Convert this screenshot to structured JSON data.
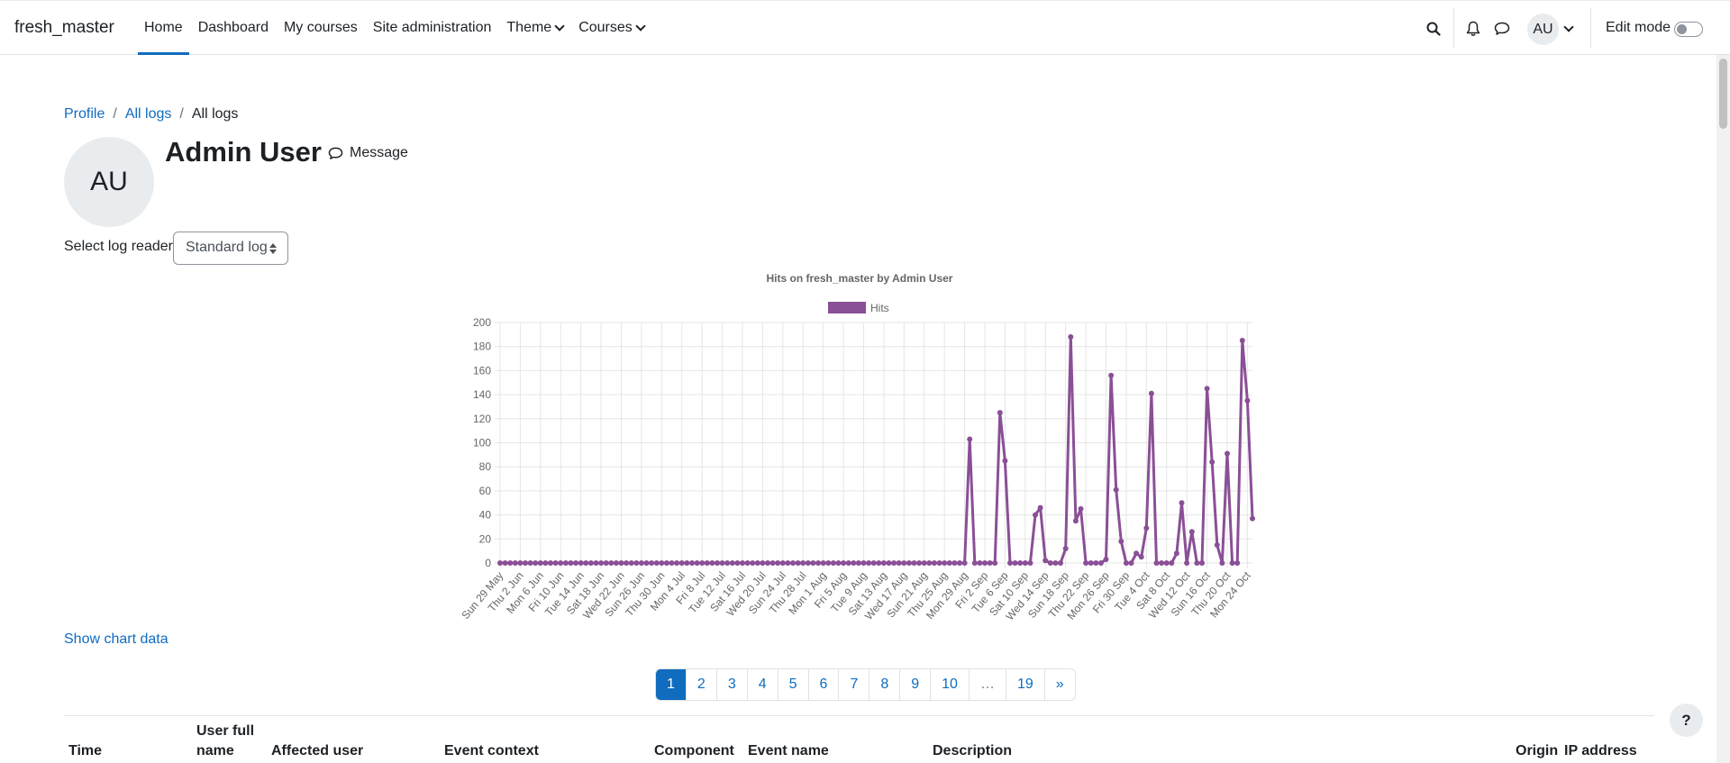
{
  "navbar": {
    "brand": "fresh_master",
    "items": [
      {
        "label": "Home",
        "active": true,
        "dropdown": false
      },
      {
        "label": "Dashboard",
        "active": false,
        "dropdown": false
      },
      {
        "label": "My courses",
        "active": false,
        "dropdown": false
      },
      {
        "label": "Site administration",
        "active": false,
        "dropdown": false
      },
      {
        "label": "Theme",
        "active": false,
        "dropdown": true
      },
      {
        "label": "Courses",
        "active": false,
        "dropdown": true
      }
    ],
    "user_initials": "AU",
    "edit_mode_label": "Edit mode",
    "edit_mode_on": false
  },
  "breadcrumb": [
    {
      "label": "Profile",
      "link": true
    },
    {
      "label": "All logs",
      "link": true
    },
    {
      "label": "All logs",
      "link": false
    }
  ],
  "header": {
    "avatar_initials": "AU",
    "title": "Admin User",
    "message_label": "Message"
  },
  "log_reader": {
    "label": "Select log reader",
    "selected": "Standard log"
  },
  "chart_data": {
    "type": "line",
    "title": "Hits on fresh_master by Admin User",
    "legend": "top",
    "color": "#8a4f96",
    "ylim": [
      0,
      200
    ],
    "yticks": [
      0,
      20,
      40,
      60,
      80,
      100,
      120,
      140,
      160,
      180,
      200
    ],
    "grid": true,
    "x_tick_labels": [
      "Sun 29 May",
      "Thu 2 Jun",
      "Mon 6 Jun",
      "Fri 10 Jun",
      "Tue 14 Jun",
      "Sat 18 Jun",
      "Wed 22 Jun",
      "Sun 26 Jun",
      "Thu 30 Jun",
      "Mon 4 Jul",
      "Fri 8 Jul",
      "Tue 12 Jul",
      "Sat 16 Jul",
      "Wed 20 Jul",
      "Sun 24 Jul",
      "Thu 28 Jul",
      "Mon 1 Aug",
      "Fri 5 Aug",
      "Tue 9 Aug",
      "Sat 13 Aug",
      "Wed 17 Aug",
      "Sun 21 Aug",
      "Thu 25 Aug",
      "Mon 29 Aug",
      "Fri 2 Sep",
      "Tue 6 Sep",
      "Sat 10 Sep",
      "Wed 14 Sep",
      "Sun 18 Sep",
      "Thu 22 Sep",
      "Mon 26 Sep",
      "Fri 30 Sep",
      "Tue 4 Oct",
      "Sat 8 Oct",
      "Wed 12 Oct",
      "Sun 16 Oct",
      "Thu 20 Oct",
      "Mon 24 Oct"
    ],
    "series": [
      {
        "name": "Hits",
        "values": [
          0,
          0,
          0,
          0,
          0,
          0,
          0,
          0,
          0,
          0,
          0,
          0,
          0,
          0,
          0,
          0,
          0,
          0,
          0,
          0,
          0,
          0,
          0,
          0,
          0,
          0,
          0,
          0,
          0,
          0,
          0,
          0,
          0,
          0,
          0,
          0,
          0,
          0,
          0,
          0,
          0,
          0,
          0,
          0,
          0,
          0,
          0,
          0,
          0,
          0,
          0,
          0,
          0,
          0,
          0,
          0,
          0,
          0,
          0,
          0,
          0,
          0,
          0,
          0,
          0,
          0,
          0,
          0,
          0,
          0,
          0,
          0,
          0,
          0,
          0,
          0,
          0,
          0,
          0,
          0,
          0,
          0,
          0,
          0,
          0,
          0,
          0,
          0,
          0,
          0,
          0,
          0,
          0,
          103,
          0,
          0,
          0,
          0,
          0,
          125,
          85,
          0,
          0,
          0,
          0,
          0,
          40,
          46,
          2,
          0,
          0,
          0,
          12,
          188,
          35,
          45,
          0,
          0,
          0,
          0,
          3,
          156,
          61,
          18,
          0,
          0,
          8,
          5,
          29,
          141,
          0,
          0,
          0,
          0,
          8,
          50,
          0,
          26,
          0,
          0,
          145,
          84,
          15,
          0,
          91,
          0,
          0,
          185,
          135,
          37
        ]
      }
    ]
  },
  "show_chart_data_label": "Show chart data",
  "pagination": {
    "pages": [
      "1",
      "2",
      "3",
      "4",
      "5",
      "6",
      "7",
      "8",
      "9",
      "10",
      "…",
      "19",
      "»"
    ],
    "active": "1"
  },
  "table": {
    "columns": [
      "Time",
      "User full name",
      "Affected user",
      "Event context",
      "Component",
      "Event name",
      "Description",
      "Origin",
      "IP address"
    ]
  },
  "help_label": "?"
}
